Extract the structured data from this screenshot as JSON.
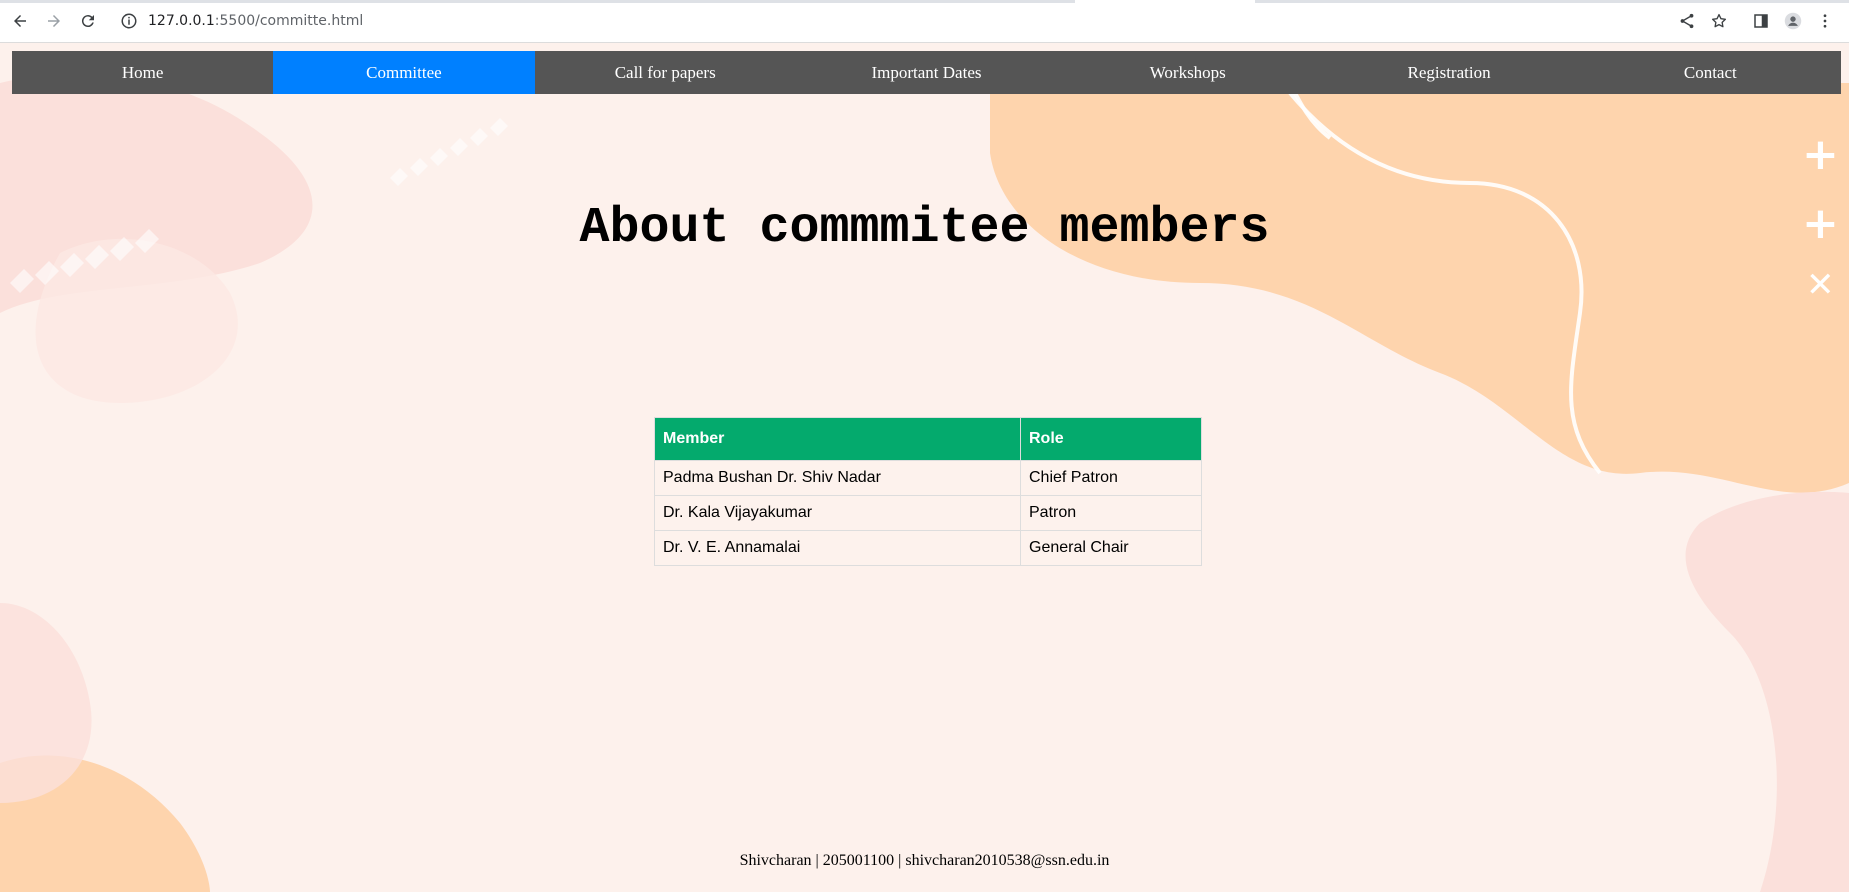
{
  "browser": {
    "url_host": "127.0.0.1",
    "url_rest": ":5500/committe.html"
  },
  "nav": {
    "items": [
      "Home",
      "Committee",
      "Call for papers",
      "Important Dates",
      "Workshops",
      "Registration",
      "Contact"
    ],
    "active_index": 1
  },
  "page": {
    "title": "About commmitee members"
  },
  "table": {
    "headers": [
      "Member",
      "Role"
    ],
    "rows": [
      [
        "Padma Bushan Dr. Shiv Nadar",
        "Chief Patron"
      ],
      [
        "Dr. Kala Vijayakumar",
        "Patron"
      ],
      [
        "Dr. V. E. Annamalai",
        "General Chair"
      ]
    ]
  },
  "footer": {
    "text": "Shivcharan | 205001100 | shivcharan2010538@ssn.edu.in"
  },
  "colors": {
    "nav_bg": "#555555",
    "nav_active": "#0080ff",
    "table_header": "#04aa6d",
    "page_bg": "#fdf1ec",
    "blob_orange": "#fed4ad",
    "blob_pink": "#fbe0db"
  },
  "icons": [
    "back-arrow-icon",
    "forward-arrow-icon",
    "reload-icon",
    "info-icon",
    "share-icon",
    "star-icon",
    "side-panel-icon",
    "profile-icon",
    "kebab-menu-icon"
  ]
}
